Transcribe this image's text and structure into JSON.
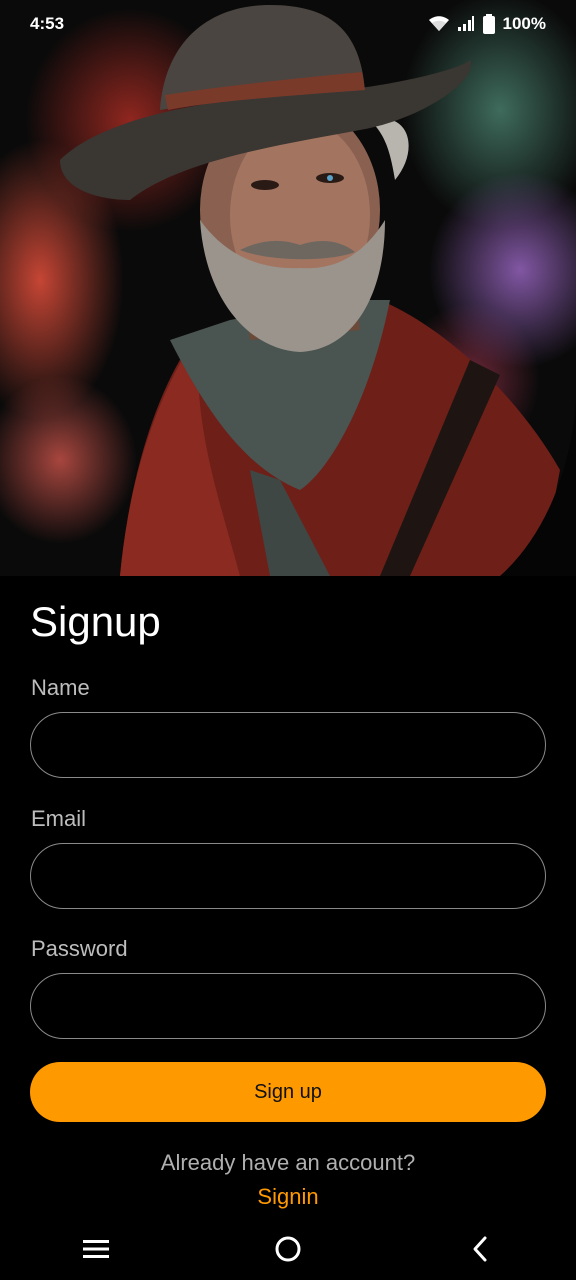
{
  "status_bar": {
    "time": "4:53",
    "battery": "100%",
    "icons": [
      "wifi-icon",
      "signal-icon",
      "battery-icon"
    ]
  },
  "hero": {
    "image": "portrait of bearded man in wide-brim hat with red and purple smoke"
  },
  "form": {
    "title": "Signup",
    "name_label": "Name",
    "name_value": "",
    "email_label": "Email",
    "email_value": "",
    "password_label": "Password",
    "password_value": "",
    "submit_label": "Sign up"
  },
  "footer": {
    "prompt": "Already have an account?",
    "signin_link": "Signin"
  },
  "nav_bar": {
    "icons": [
      "menu-icon",
      "home-icon",
      "back-icon"
    ]
  },
  "colors": {
    "accent": "#ff9900",
    "background": "#000000",
    "field_border": "#8a8a8a"
  }
}
